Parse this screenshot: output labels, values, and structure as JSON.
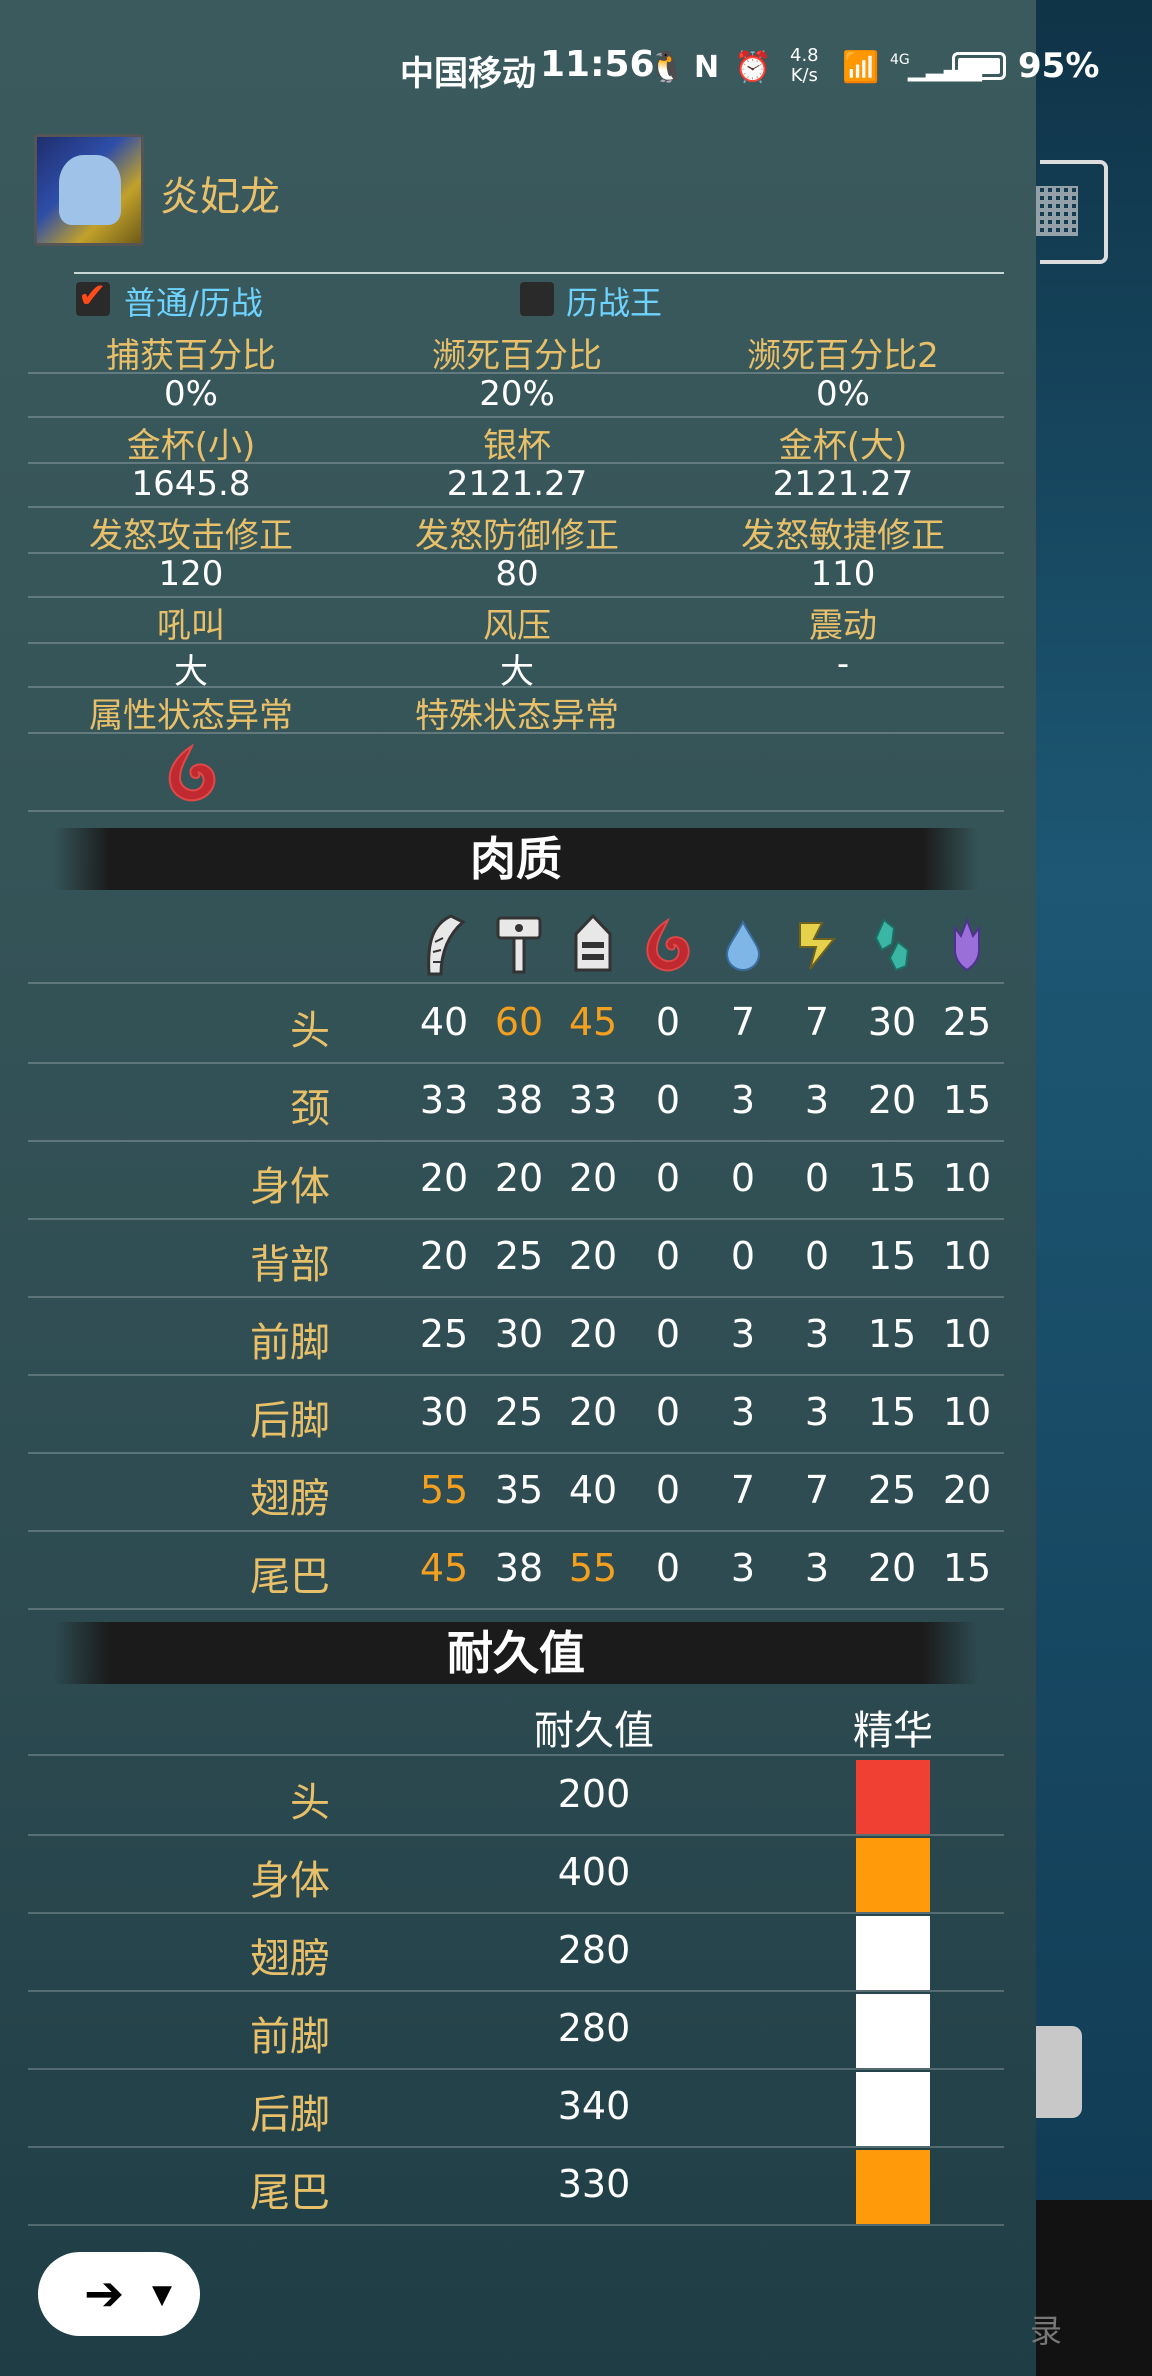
{
  "status_bar": {
    "carrier": "中国移动",
    "time": "11:56",
    "net_speed_top": "4.8",
    "net_speed_bottom": "K/s",
    "network": "4G",
    "battery": "95%"
  },
  "monster": {
    "name": "炎妃龙"
  },
  "modes": {
    "mode_a_label": "普通/历战",
    "mode_b_label": "历战王",
    "mode_a_checked": true,
    "mode_b_checked": false
  },
  "info": {
    "capture_label": "捕获百分比",
    "capture_value": "0%",
    "dying_label": "濒死百分比",
    "dying_value": "20%",
    "dying2_label": "濒死百分比2",
    "dying2_value": "0%",
    "gold_small_label": "金杯(小)",
    "gold_small_value": "1645.8",
    "silver_label": "银杯",
    "silver_value": "2121.27",
    "gold_large_label": "金杯(大)",
    "gold_large_value": "2121.27",
    "rage_atk_label": "发怒攻击修正",
    "rage_atk_value": "120",
    "rage_def_label": "发怒防御修正",
    "rage_def_value": "80",
    "rage_agi_label": "发怒敏捷修正",
    "rage_agi_value": "110",
    "roar_label": "吼叫",
    "roar_value": "大",
    "wind_label": "风压",
    "wind_value": "大",
    "tremor_label": "震动",
    "tremor_value": "-",
    "elem_ailment_label": "属性状态异常",
    "special_ailment_label": "特殊状态异常",
    "elem_ailment_icon": "fire-blight-icon"
  },
  "hitzones": {
    "title": "肉质",
    "column_icons": [
      "cut-icon",
      "impact-icon",
      "shot-icon",
      "fire-icon",
      "water-icon",
      "thunder-icon",
      "ice-icon",
      "dragon-icon"
    ],
    "rows": [
      {
        "part": "头",
        "values": [
          "40",
          "60",
          "45",
          "0",
          "7",
          "7",
          "30",
          "25"
        ],
        "highlight": [
          false,
          true,
          true,
          false,
          false,
          false,
          false,
          false
        ]
      },
      {
        "part": "颈",
        "values": [
          "33",
          "38",
          "33",
          "0",
          "3",
          "3",
          "20",
          "15"
        ],
        "highlight": [
          false,
          false,
          false,
          false,
          false,
          false,
          false,
          false
        ]
      },
      {
        "part": "身体",
        "values": [
          "20",
          "20",
          "20",
          "0",
          "0",
          "0",
          "15",
          "10"
        ],
        "highlight": [
          false,
          false,
          false,
          false,
          false,
          false,
          false,
          false
        ]
      },
      {
        "part": "背部",
        "values": [
          "20",
          "25",
          "20",
          "0",
          "0",
          "0",
          "15",
          "10"
        ],
        "highlight": [
          false,
          false,
          false,
          false,
          false,
          false,
          false,
          false
        ]
      },
      {
        "part": "前脚",
        "values": [
          "25",
          "30",
          "20",
          "0",
          "3",
          "3",
          "15",
          "10"
        ],
        "highlight": [
          false,
          false,
          false,
          false,
          false,
          false,
          false,
          false
        ]
      },
      {
        "part": "后脚",
        "values": [
          "30",
          "25",
          "20",
          "0",
          "3",
          "3",
          "15",
          "10"
        ],
        "highlight": [
          false,
          false,
          false,
          false,
          false,
          false,
          false,
          false
        ]
      },
      {
        "part": "翅膀",
        "values": [
          "55",
          "35",
          "40",
          "0",
          "7",
          "7",
          "25",
          "20"
        ],
        "highlight": [
          true,
          false,
          false,
          false,
          false,
          false,
          false,
          false
        ]
      },
      {
        "part": "尾巴",
        "values": [
          "45",
          "38",
          "55",
          "0",
          "3",
          "3",
          "20",
          "15"
        ],
        "highlight": [
          true,
          false,
          true,
          false,
          false,
          false,
          false,
          false
        ]
      }
    ]
  },
  "durability": {
    "title": "耐久值",
    "col_durability": "耐久值",
    "col_essence": "精华",
    "rows": [
      {
        "part": "头",
        "value": "200",
        "essence_color": "#f04034"
      },
      {
        "part": "身体",
        "value": "400",
        "essence_color": "#ff9a0a"
      },
      {
        "part": "翅膀",
        "value": "280",
        "essence_color": "#ffffff"
      },
      {
        "part": "前脚",
        "value": "280",
        "essence_color": "#ffffff"
      },
      {
        "part": "后脚",
        "value": "340",
        "essence_color": "#ffffff"
      },
      {
        "part": "尾巴",
        "value": "330",
        "essence_color": "#ff9a0a"
      }
    ]
  },
  "colors": {
    "label_gold": "#e9c06a",
    "highlight_orange": "#f3a020",
    "mode_cyan": "#6fd3ff"
  },
  "nav": {
    "back_icon": "back-arrow-icon",
    "dropdown_icon": "caret-down-icon"
  }
}
